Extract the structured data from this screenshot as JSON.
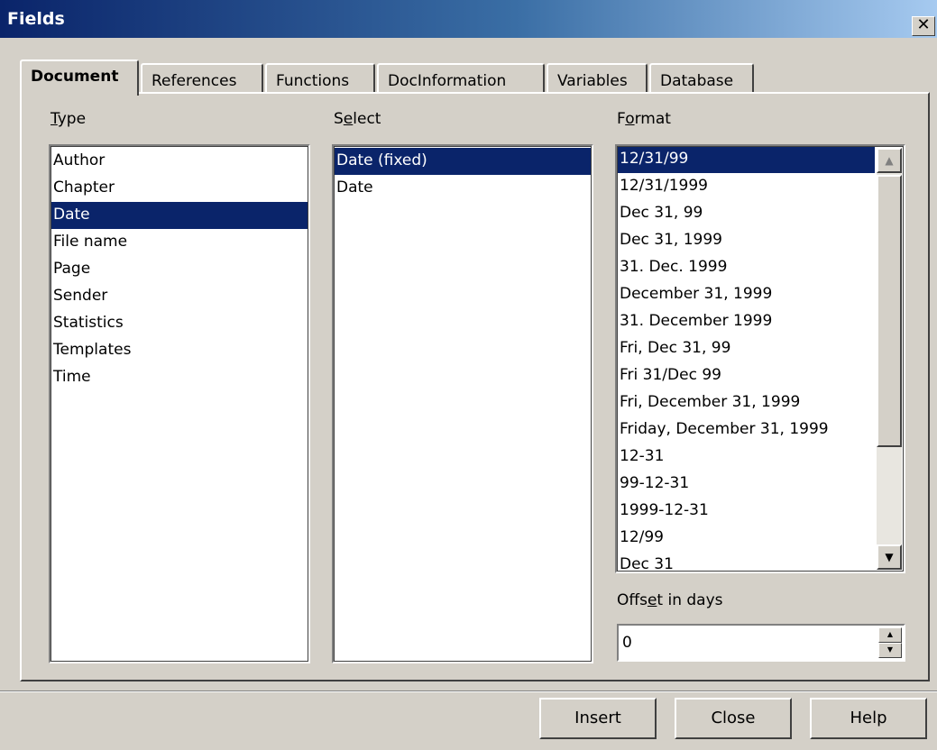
{
  "window": {
    "title": "Fields",
    "close_glyph": "✕"
  },
  "tabs": [
    {
      "label": "Document",
      "active": true
    },
    {
      "label": "References",
      "active": false
    },
    {
      "label": "Functions",
      "active": false
    },
    {
      "label": "DocInformation",
      "active": false
    },
    {
      "label": "Variables",
      "active": false
    },
    {
      "label": "Database",
      "active": false
    }
  ],
  "type": {
    "label_mnemonic": "T",
    "label_rest": "ype",
    "items": [
      "Author",
      "Chapter",
      "Date",
      "File name",
      "Page",
      "Sender",
      "Statistics",
      "Templates",
      "Time"
    ],
    "selected": "Date"
  },
  "select": {
    "label_before": "S",
    "label_mnemonic": "e",
    "label_rest": "lect",
    "items": [
      "Date (fixed)",
      "Date"
    ],
    "selected": "Date (fixed)"
  },
  "format": {
    "label_before": "F",
    "label_mnemonic": "o",
    "label_rest": "rmat",
    "items": [
      "12/31/99",
      "12/31/1999",
      "Dec 31, 99",
      "Dec 31, 1999",
      "31. Dec. 1999",
      "December 31, 1999",
      "31. December 1999",
      "Fri, Dec 31, 99",
      "Fri 31/Dec 99",
      "Fri, December 31, 1999",
      "Friday, December 31, 1999",
      "12-31",
      "99-12-31",
      "1999-12-31",
      "12/99",
      "Dec 31"
    ],
    "selected": "12/31/99",
    "scroll_up_glyph": "▲",
    "scroll_down_glyph": "▼"
  },
  "offset": {
    "label_before": "Offs",
    "label_mnemonic": "e",
    "label_rest": "t in days",
    "value": "0",
    "up_glyph": "▲",
    "down_glyph": "▼"
  },
  "buttons": {
    "insert": "Insert",
    "close": "Close",
    "help": "Help"
  }
}
